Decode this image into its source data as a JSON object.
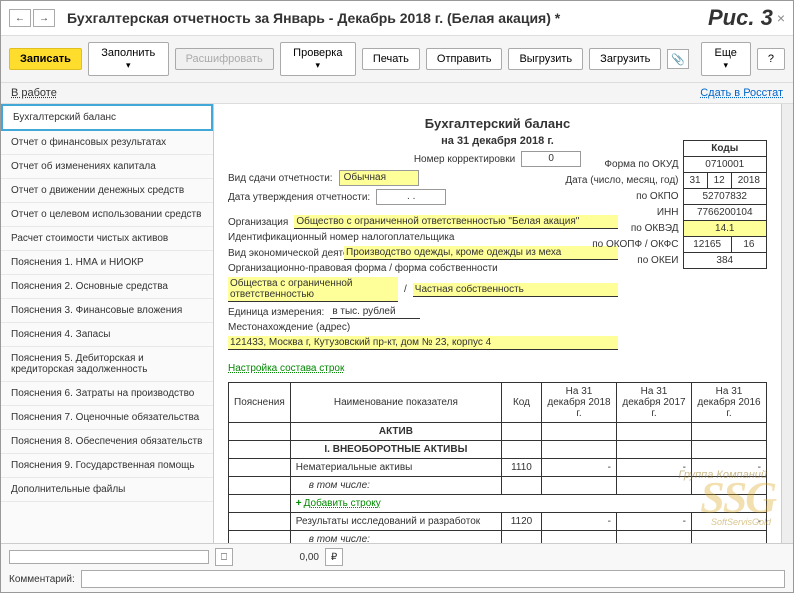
{
  "titlebar": {
    "title": "Бухгалтерская отчетность за Январь - Декабрь 2018 г. (Белая акация) *",
    "fig": "Рис. 3"
  },
  "toolbar": {
    "write": "Записать",
    "fill": "Заполнить",
    "decode": "Расшифровать",
    "check": "Проверка",
    "print": "Печать",
    "send": "Отправить",
    "upload": "Выгрузить",
    "download": "Загрузить",
    "more": "Еще",
    "help": "?"
  },
  "status": {
    "work": "В работе",
    "submit": "Сдать в Росстат"
  },
  "sidebar": {
    "items": [
      "Бухгалтерский баланс",
      "Отчет о финансовых результатах",
      "Отчет об изменениях капитала",
      "Отчет о движении денежных средств",
      "Отчет о целевом использовании средств",
      "Расчет стоимости чистых активов",
      "Пояснения 1. НМА и НИОКР",
      "Пояснения 2. Основные средства",
      "Пояснения 3. Финансовые вложения",
      "Пояснения 4. Запасы",
      "Пояснения 5. Дебиторская и кредиторская задолженность",
      "Пояснения 6. Затраты на производство",
      "Пояснения 7. Оценочные обязательства",
      "Пояснения 8. Обеспечения обязательств",
      "Пояснения 9. Государственная помощь",
      "Дополнительные файлы"
    ]
  },
  "form": {
    "title": "Бухгалтерский баланс",
    "subtitle": "на 31 декабря 2018 г.",
    "correction_label": "Номер корректировки",
    "correction_value": "0",
    "delivery_label": "Вид сдачи отчетности:",
    "delivery_value": "Обычная",
    "approve_date_label": "Дата утверждения отчетности:",
    "approve_date_value": ".   .",
    "org_label": "Организация",
    "org_value": "Общество с ограниченной ответственностью \"Белая акация\"",
    "inn_label": "Идентификационный номер налогоплательщика",
    "activity_label": "Вид экономической деятельности",
    "activity_value": "Производство одежды, кроме одежды из меха",
    "legal_form_label": "Организационно-правовая форма / форма собственности",
    "legal_form_value1": "Общества с ограниченной ответственностью",
    "legal_form_value2": "Частная собственность",
    "unit_label": "Единица измерения:",
    "unit_value": "в тыс. рублей",
    "address_label": "Местонахождение (адрес)",
    "address_value": "121433, Москва г, Кутузовский пр-кт, дом № 23, корпус 4",
    "settings_link": "Настройка состава строк"
  },
  "codes": {
    "header": "Коды",
    "okud_label": "Форма по ОКУД",
    "okud": "0710001",
    "date_label": "Дата (число, месяц, год)",
    "date_d": "31",
    "date_m": "12",
    "date_y": "2018",
    "okpo_label": "по ОКПО",
    "okpo": "52707832",
    "inn_label": "ИНН",
    "inn": "7766200104",
    "okved_label": "по ОКВЭД",
    "okved": "14.1",
    "okopf_label": "по ОКОПФ / ОКФС",
    "okopf": "12165",
    "okfs": "16",
    "okei_label": "по ОКЕИ",
    "okei": "384"
  },
  "grid": {
    "cols": [
      "Пояснения",
      "Наименование показателя",
      "Код",
      "На 31 декабря 2018 г.",
      "На 31 декабря 2017 г.",
      "На 31 декабря 2016 г."
    ],
    "active": "АКТИВ",
    "section1": "I. ВНЕОБОРОТНЫЕ АКТИВЫ",
    "r1": "Нематериальные активы",
    "c1": "1110",
    "including": "в том числе:",
    "add_row": "Добавить строку",
    "r2": "Результаты исследований и разработок",
    "c2": "1120"
  },
  "footer": {
    "val": "0,00",
    "cur": "₽",
    "comment_label": "Комментарий:"
  },
  "watermark": {
    "brand": "SSG",
    "top": "Группа Компаний",
    "sub": "SoftServisGold"
  }
}
